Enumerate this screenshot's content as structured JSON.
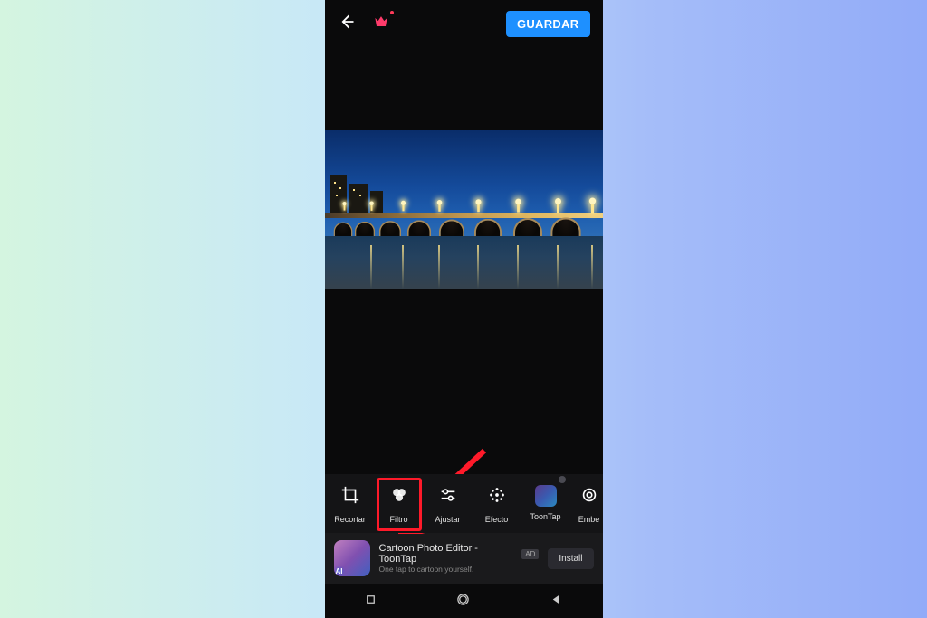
{
  "header": {
    "save_label": "GUARDAR"
  },
  "tools": [
    {
      "label": "Recortar",
      "icon": "crop-icon",
      "highlighted": false
    },
    {
      "label": "Filtro",
      "icon": "filter-icon",
      "highlighted": true
    },
    {
      "label": "Ajustar",
      "icon": "adjust-icon",
      "highlighted": false
    },
    {
      "label": "Efecto",
      "icon": "effect-icon",
      "highlighted": false
    },
    {
      "label": "ToonTap",
      "icon": "toontap-icon",
      "highlighted": false
    },
    {
      "label": "Embe",
      "icon": "blur-icon",
      "highlighted": false
    }
  ],
  "ad": {
    "title": "Cartoon Photo Editor - ToonTap",
    "subtitle": "One tap to cartoon yourself.",
    "badge": "AD",
    "install_label": "Install",
    "thumb_ai": "AI"
  },
  "annotation": {
    "arrow_target": "Filtro"
  }
}
